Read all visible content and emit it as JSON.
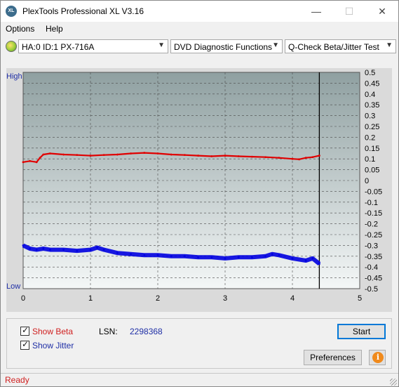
{
  "window": {
    "title": "PlexTools Professional XL V3.16",
    "icon_text": "XL",
    "min_glyph": "—",
    "max_glyph": "☐",
    "close_glyph": "✕"
  },
  "menu": [
    "Options",
    "Help"
  ],
  "toolbar": {
    "drive": "HA:0 ID:1  PX-716A",
    "function": "DVD Diagnostic Functions",
    "test": "Q-Check Beta/Jitter Test"
  },
  "chart_labels": {
    "high": "High",
    "low": "Low"
  },
  "chart_data": {
    "type": "line",
    "xlim": [
      0,
      5
    ],
    "ylim": [
      -0.5,
      0.5
    ],
    "x_ticks": [
      "0",
      "1",
      "2",
      "3",
      "4",
      "5"
    ],
    "y_ticks": [
      "0.5",
      "0.45",
      "0.4",
      "0.35",
      "0.3",
      "0.25",
      "0.2",
      "0.15",
      "0.1",
      "0.05",
      "0",
      "-0.05",
      "-0.1",
      "-0.15",
      "-0.2",
      "-0.25",
      "-0.3",
      "-0.35",
      "-0.4",
      "-0.45",
      "-0.5"
    ],
    "y_tick_values": [
      0.5,
      0.45,
      0.4,
      0.35,
      0.3,
      0.25,
      0.2,
      0.15,
      0.1,
      0.05,
      0,
      -0.05,
      -0.1,
      -0.15,
      -0.2,
      -0.25,
      -0.3,
      -0.35,
      -0.4,
      -0.45,
      -0.5
    ],
    "end_marker_x": 4.4,
    "grid": true,
    "series": [
      {
        "name": "Beta",
        "color": "#e00000",
        "x": [
          0,
          0.1,
          0.2,
          0.25,
          0.3,
          0.4,
          0.6,
          0.8,
          1.0,
          1.2,
          1.4,
          1.6,
          1.8,
          2.0,
          2.2,
          2.4,
          2.6,
          2.8,
          3.0,
          3.2,
          3.4,
          3.6,
          3.8,
          4.0,
          4.1,
          4.2,
          4.3,
          4.4
        ],
        "values": [
          0.085,
          0.09,
          0.085,
          0.105,
          0.12,
          0.125,
          0.12,
          0.118,
          0.115,
          0.118,
          0.12,
          0.125,
          0.128,
          0.125,
          0.12,
          0.118,
          0.115,
          0.112,
          0.115,
          0.112,
          0.11,
          0.108,
          0.105,
          0.1,
          0.098,
          0.105,
          0.108,
          0.115
        ]
      },
      {
        "name": "Jitter",
        "color": "#0000e0",
        "x": [
          0,
          0.1,
          0.2,
          0.3,
          0.4,
          0.6,
          0.8,
          1.0,
          1.1,
          1.2,
          1.4,
          1.6,
          1.8,
          2.0,
          2.2,
          2.4,
          2.6,
          2.8,
          3.0,
          3.2,
          3.4,
          3.6,
          3.7,
          3.8,
          4.0,
          4.2,
          4.3,
          4.4
        ],
        "values": [
          -0.3,
          -0.315,
          -0.32,
          -0.315,
          -0.32,
          -0.32,
          -0.325,
          -0.32,
          -0.31,
          -0.32,
          -0.335,
          -0.34,
          -0.345,
          -0.345,
          -0.35,
          -0.35,
          -0.355,
          -0.355,
          -0.36,
          -0.355,
          -0.355,
          -0.35,
          -0.34,
          -0.345,
          -0.36,
          -0.37,
          -0.36,
          -0.385
        ]
      }
    ]
  },
  "options": {
    "show_beta": {
      "label": "Show Beta",
      "checked": true,
      "color": "#d02020"
    },
    "show_jitter": {
      "label": "Show Jitter",
      "checked": true,
      "color": "#1f2fa6"
    },
    "lsn_label": "LSN:",
    "lsn_value": "2298368",
    "start": "Start",
    "preferences": "Preferences",
    "info_glyph": "i"
  },
  "status": "Ready"
}
